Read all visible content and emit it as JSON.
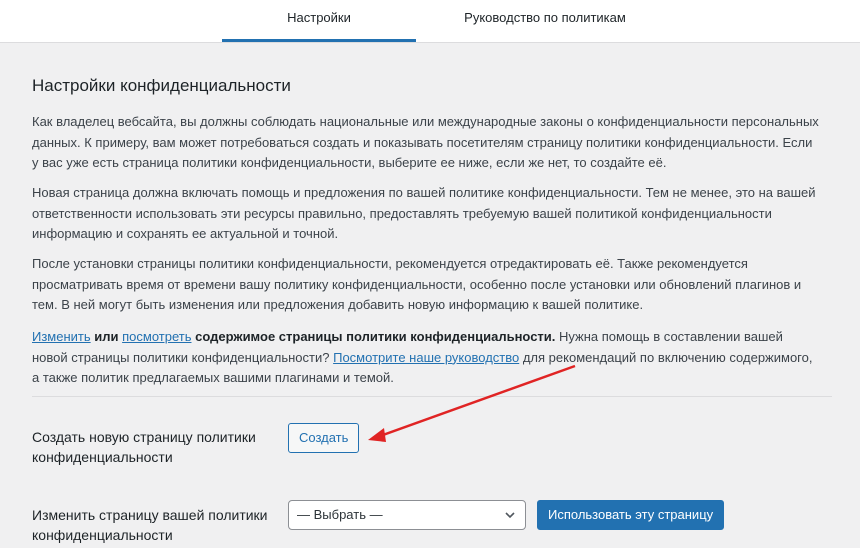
{
  "tabs": [
    {
      "label": "Настройки",
      "active": true
    },
    {
      "label": "Руководство по политикам",
      "active": false
    }
  ],
  "page": {
    "title": "Настройки конфиденциальности",
    "paragraph1": "Как владелец вебсайта, вы должны соблюдать национальные или международные законы о конфиденциальности персональных данных. К примеру, вам может потребоваться создать и показывать посетителям страницу политики конфиденциальности. Если у вас уже есть страница политики конфиденциальности, выберите ее ниже, если же нет, то создайте её.",
    "paragraph2": "Новая страница должна включать помощь и предложения по вашей политике конфиденциальности. Тем не менее, это на вашей ответственности использовать эти ресурсы правильно, предоставлять требуемую вашей политикой конфиденциальности информацию и сохранять ее актуальной и точной.",
    "paragraph3": "После установки страницы политики конфиденциальности, рекомендуется отредактировать её. Также рекомендуется просматривать время от времени вашу политику конфиденциальности, особенно после установки или обновлений плагинов и тем. В ней могут быть изменения или предложения добавить новую информацию к вашей политике.",
    "p4": {
      "edit_link": "Изменить",
      "or": " или ",
      "view_link": "посмотреть",
      "bold_rest": " содержимое страницы политики конфиденциальности.",
      "text1": " Нужна помощь в составлении вашей новой страницы политики конфиденциальности? ",
      "guide_link": "Посмотрите наше руководство",
      "text2": " для рекомендаций по включению содержимого, а также политик предлагаемых вашими плагинами и темой."
    }
  },
  "create_row": {
    "label": "Создать новую страницу политики конфиденциальности",
    "button": "Создать"
  },
  "change_row": {
    "label": "Изменить страницу вашей политики конфиденциальности",
    "select_value": "— Выбрать —",
    "button": "Использовать эту страницу"
  },
  "colors": {
    "accent": "#2271b1",
    "arrow": "#e02424",
    "background": "#f0f0f1"
  },
  "icons": {
    "select_chevron": "chevron-down-icon",
    "annotation": "red-arrow-annotation"
  }
}
